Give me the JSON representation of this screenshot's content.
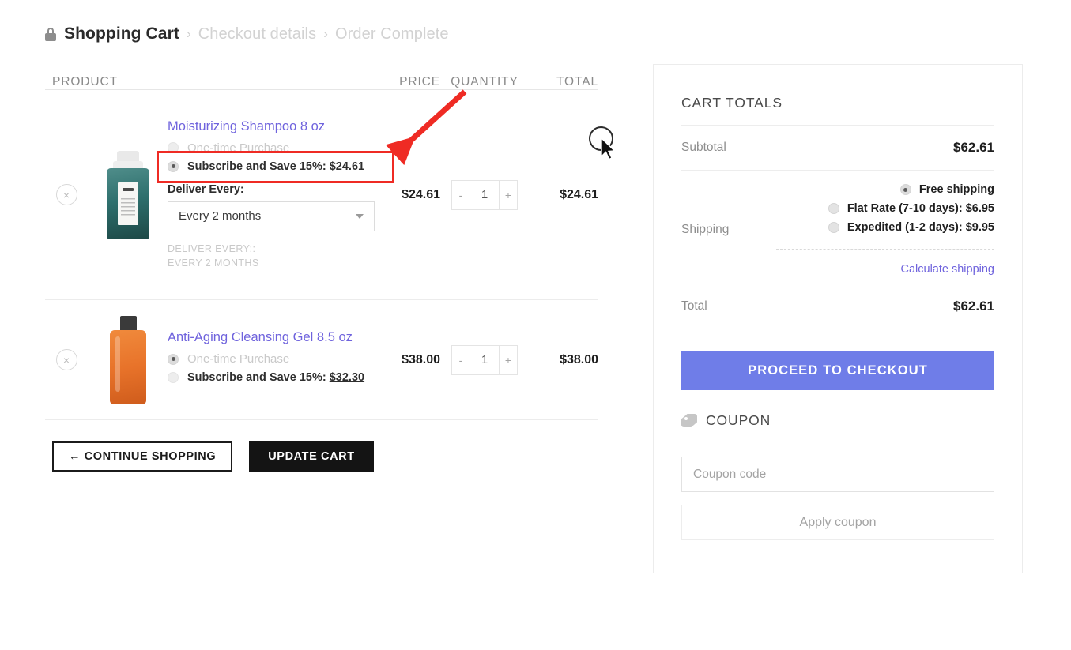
{
  "breadcrumb": {
    "lock_icon": "lock-icon",
    "active": "Shopping Cart",
    "sep1": "›",
    "step2": "Checkout details",
    "sep2": "›",
    "step3": "Order Complete"
  },
  "table": {
    "headers": {
      "product": "PRODUCT",
      "price": "PRICE",
      "quantity": "QUANTITY",
      "total": "TOTAL"
    },
    "remove_glyph": "×",
    "minus": "-",
    "plus": "+",
    "rows": [
      {
        "name": "Moisturizing Shampoo 8 oz",
        "option_onetime": "One-time Purchase",
        "option_subscribe": "Subscribe and Save 15%:",
        "subscribe_price": "$24.61",
        "deliver_label": "Deliver Every:",
        "deliver_value": "Every 2 months",
        "meta_line1": "DELIVER EVERY::",
        "meta_line2": "EVERY 2 MONTHS",
        "price": "$24.61",
        "qty": "1",
        "total": "$24.61"
      },
      {
        "name": "Anti-Aging Cleansing Gel 8.5 oz",
        "option_onetime": "One-time Purchase",
        "option_subscribe": "Subscribe and Save 15%:",
        "subscribe_price": "$32.30",
        "price": "$38.00",
        "qty": "1",
        "total": "$38.00"
      }
    ]
  },
  "actions": {
    "continue_shopping": "← CONTINUE SHOPPING",
    "update_cart": "UPDATE CART"
  },
  "totals": {
    "title": "CART TOTALS",
    "subtotal_label": "Subtotal",
    "subtotal_value": "$62.61",
    "shipping_label": "Shipping",
    "shipping_options": [
      {
        "label": "Free shipping",
        "selected": true
      },
      {
        "label": "Flat Rate (7-10 days): $6.95",
        "selected": false
      },
      {
        "label": "Expedited (1-2 days): $9.95",
        "selected": false
      }
    ],
    "calculate_link": "Calculate shipping",
    "total_label": "Total",
    "total_value": "$62.61",
    "checkout_button": "PROCEED TO CHECKOUT"
  },
  "coupon": {
    "icon": "tag-icon",
    "title": "COUPON",
    "placeholder": "Coupon code",
    "value": "",
    "apply_button": "Apply coupon"
  },
  "colors": {
    "link_purple": "#6f63dd",
    "checkout_blue": "#6f7de8",
    "annotation_red": "#ef2b24",
    "dark_button": "#141414"
  }
}
